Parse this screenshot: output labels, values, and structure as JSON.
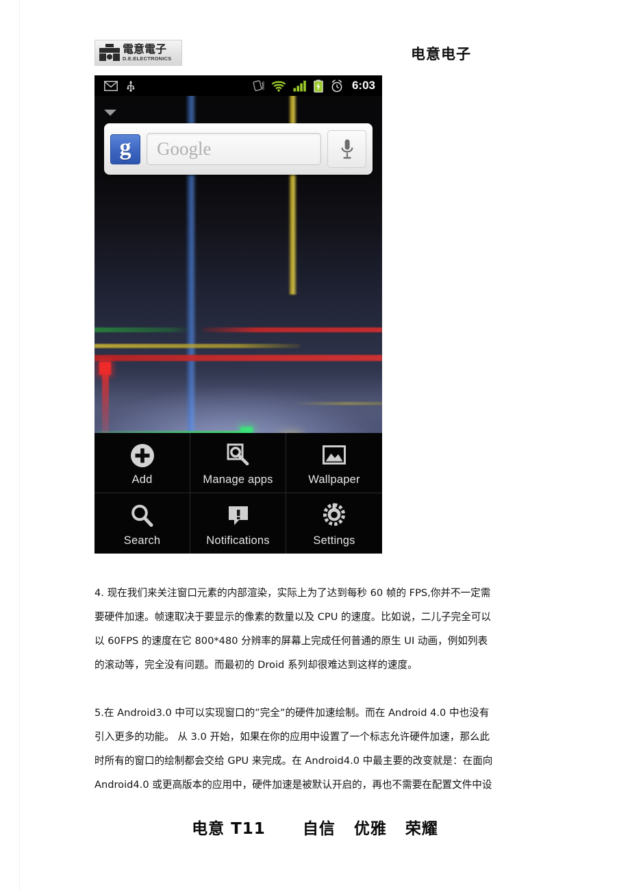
{
  "header": {
    "logo_cn": "電意電子",
    "logo_en": "D.E.ELECTRONICS",
    "title": "电意电子"
  },
  "phone_screenshot": {
    "statusbar": {
      "left_icons": [
        "gmail-icon",
        "usb-icon"
      ],
      "right_icons": [
        "vibrate-icon",
        "wifi-icon",
        "signal-icon",
        "battery-charging-icon",
        "alarm-clock-icon"
      ],
      "clock": "6:03"
    },
    "search_widget": {
      "logo_letter": "g",
      "placeholder": "Google",
      "mic_icon": "microphone-icon",
      "caret_icon": "chevron-down-icon"
    },
    "menu": {
      "items": [
        {
          "label": "Add",
          "icon": "plus-circle-icon"
        },
        {
          "label": "Manage apps",
          "icon": "wrench-icon"
        },
        {
          "label": "Wallpaper",
          "icon": "picture-icon"
        },
        {
          "label": "Search",
          "icon": "magnifier-icon"
        },
        {
          "label": "Notifications",
          "icon": "notification-bubble-icon"
        },
        {
          "label": "Settings",
          "icon": "gear-icon"
        }
      ]
    }
  },
  "content": {
    "paragraph_4": {
      "lines": [
        "4. 现在我们来关注窗口元素的内部渲染，实际上为了达到每秒 60 帧的 FPS,你并不一定需",
        "要硬件加速。帧速取决于要显示的像素的数量以及 CPU 的速度。比如说，二儿子完全可以",
        "以 60FPS 的速度在它 800*480 分辨率的屏幕上完成任何普通的原生 UI 动画，例如列表",
        "的滚动等，完全没有问题。而最初的 Droid 系列却很难达到这样的速度。"
      ]
    },
    "paragraph_5": {
      "lines": [
        "5.在 Android3.0 中可以实现窗口的”完全”的硬件加速绘制。而在 Android 4.0 中也没有",
        "引入更多的功能。 从 3.0 开始，如果在你的应用中设置了一个标志允许硬件加速，那么此",
        "时所有的窗口的绘制都会交给 GPU 来完成。在 Android4.0 中最主要的改变就是：在面向",
        "Android4.0 或更高版本的应用中，硬件加速是被默认开启的，再也不需要在配置文件中设"
      ]
    }
  },
  "footer": {
    "text": "电意 T11      自信   优雅   荣耀"
  },
  "colors": {
    "status_green": "#a4c639",
    "google_blue": "#3f68c4",
    "page_background": "#ffffff",
    "screen_black": "#000000"
  }
}
